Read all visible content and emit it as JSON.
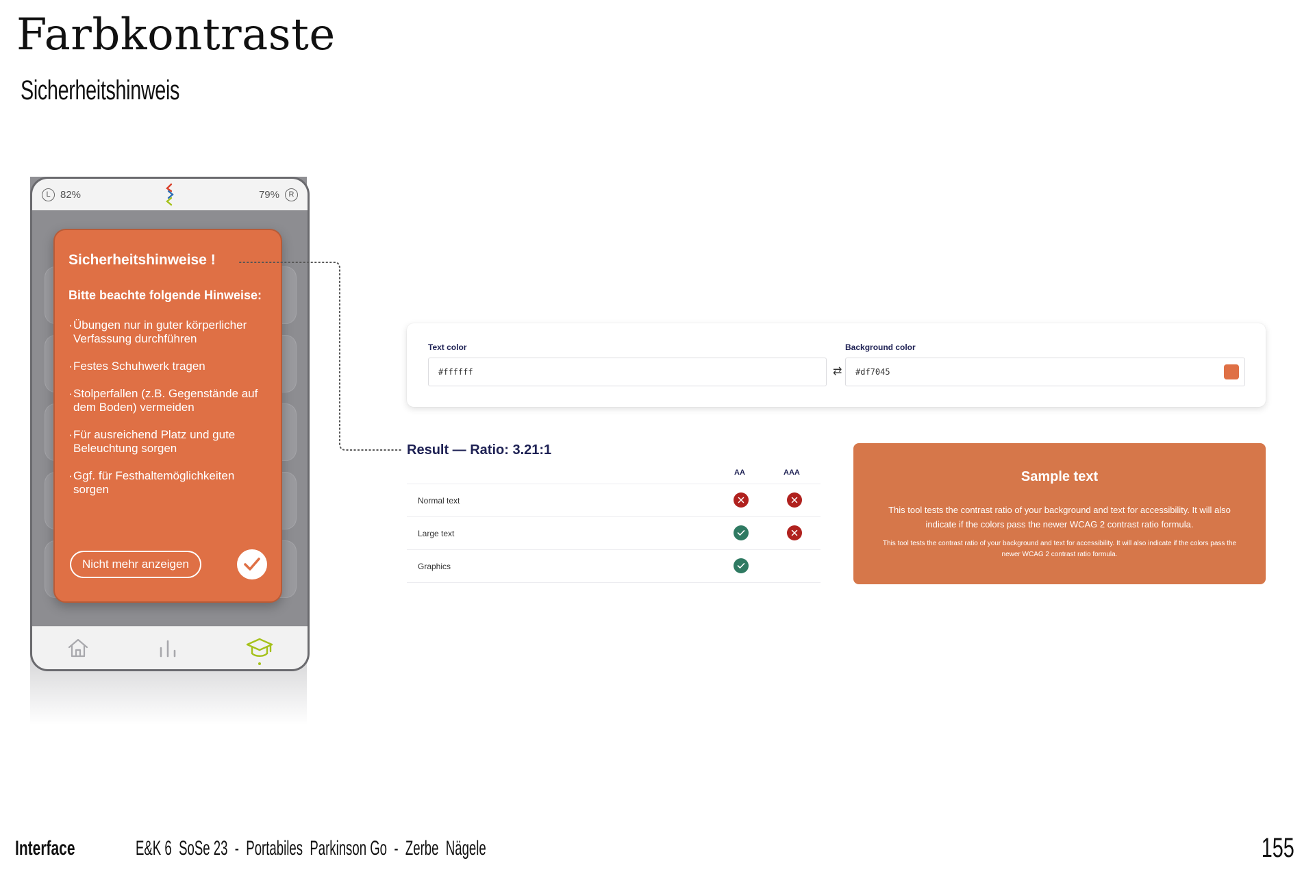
{
  "page": {
    "title": "Farbkontraste",
    "subtitle": "Sicherheitshinweis"
  },
  "phone": {
    "status": {
      "left_letter": "L",
      "left_battery": "82%",
      "right_battery": "79%",
      "right_letter": "R"
    },
    "modal": {
      "title": "Sicherheitshinweise !",
      "intro": "Bitte beachte folgende Hinweise:",
      "items": [
        "Übungen nur in guter körperlicher Verfassung durchführen",
        "Festes Schuhwerk tragen",
        "Stolperfallen (z.B. Gegenstände auf dem Boden) vermeiden",
        "Für ausreichend Platz und gute Beleuchtung sorgen",
        "Ggf. für Festhaltemöglichkeiten sorgen"
      ],
      "dismiss_label": "Nicht mehr anzeigen",
      "background_color": "#df7045"
    },
    "nav": {
      "icons": [
        "home-icon",
        "chart-icon",
        "graduation-cap-icon"
      ],
      "active": "graduation-cap-icon",
      "active_color": "#a5c11a"
    }
  },
  "contrast_tool": {
    "text_color_label": "Text color",
    "text_color_value": "#ffffff",
    "background_color_label": "Background color",
    "background_color_value": "#df7045",
    "swatch_color": "#df7045",
    "result_title": "Result — Ratio: 3.21:1",
    "columns": [
      "AA",
      "AAA"
    ],
    "rows": [
      {
        "label": "Normal text",
        "AA": "fail",
        "AAA": "fail"
      },
      {
        "label": "Large text",
        "AA": "pass",
        "AAA": "fail"
      },
      {
        "label": "Graphics",
        "AA": "pass",
        "AAA": ""
      }
    ],
    "status_colors": {
      "pass": "#2f7a62",
      "fail": "#b0211e"
    },
    "sample": {
      "heading": "Sample text",
      "large_text": "This tool tests the contrast ratio of your background and text for accessibility. It will also indicate if the colors pass the newer WCAG 2 contrast ratio formula.",
      "small_text": "This tool tests the contrast ratio of your background and text for accessibility. It will also indicate if the colors pass the newer WCAG 2 contrast ratio formula.",
      "background_color": "#d6774a"
    }
  },
  "footer": {
    "section": "Interface",
    "meta": "E&K 6  SoSe 23  -  Portabiles  Parkinson Go  -  Zerbe  Nägele",
    "page_number": "155"
  }
}
